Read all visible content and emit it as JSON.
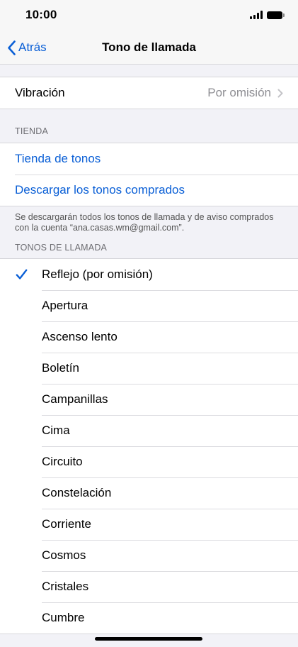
{
  "status_bar": {
    "time": "10:00"
  },
  "nav": {
    "back_label": "Atrás",
    "title": "Tono de llamada"
  },
  "vibration": {
    "label": "Vibración",
    "value": "Por omisión"
  },
  "store": {
    "header": "TIENDA",
    "items": [
      "Tienda de tonos",
      "Descargar los tonos comprados"
    ],
    "footer": "Se descargarán todos los tonos de llamada y de aviso comprados con la cuenta “ana.casas.wm@gmail.com”."
  },
  "ringtones": {
    "header": "TONOS DE LLAMADA",
    "selected_index": 0,
    "items": [
      "Reflejo (por omisión)",
      "Apertura",
      "Ascenso lento",
      "Boletín",
      "Campanillas",
      "Cima",
      "Circuito",
      "Constelación",
      "Corriente",
      "Cosmos",
      "Cristales",
      "Cumbre"
    ]
  },
  "colors": {
    "accent": "#0a5fd6",
    "background": "#f2f2f7",
    "secondary_text": "#8e8e93"
  },
  "icons": [
    "chevron-left-icon",
    "chevron-right-icon",
    "checkmark-icon",
    "signal-icon",
    "battery-icon"
  ]
}
